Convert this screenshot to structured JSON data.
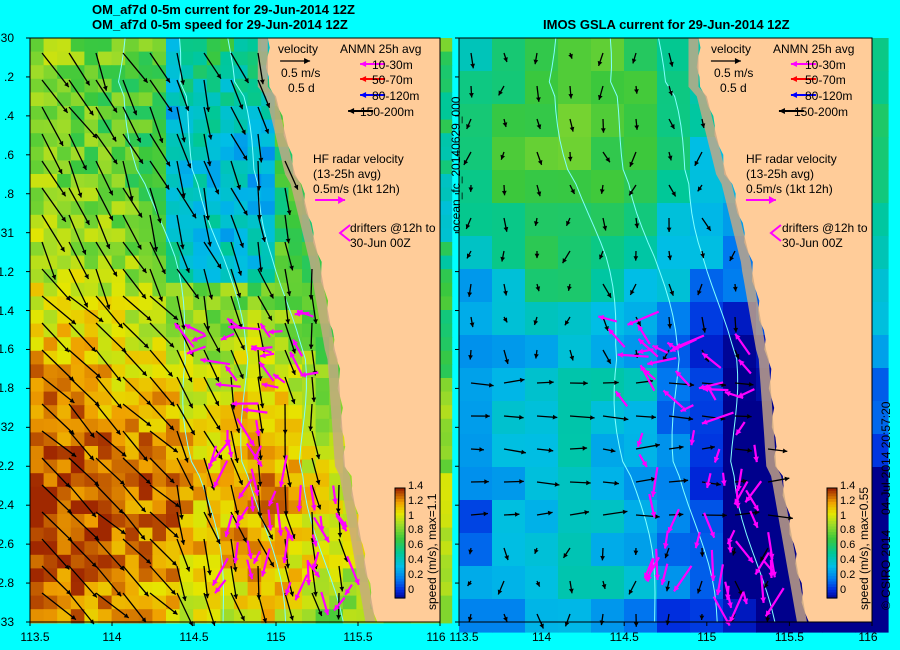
{
  "left_panel": {
    "title_line1": "OM_af7d 0-5m current for 29-Jun-2014 12Z",
    "title_line2": "OM_af7d 0-5m speed for 29-Jun-2014 12Z",
    "colorbar_label": "speed (m/s), max=1.1"
  },
  "right_panel": {
    "title_line1": "IMOS GSLA current for 29-Jun-2014 12Z",
    "side_label": "ocean_fc_20140629_000",
    "colorbar_label": "speed (m/s), max=0.55"
  },
  "legend": {
    "velocity_title": "velocity",
    "velocity_scale": "0.5 m/s",
    "velocity_time": "0.5 d",
    "anmn_title": "ANMN 25h avg",
    "anmn_items": [
      {
        "label": "10-30m",
        "color": "#FF00FF"
      },
      {
        "label": "50-70m",
        "color": "#FF0000"
      },
      {
        "label": "80-120m",
        "color": "#0000FF"
      },
      {
        "label": "150-200m",
        "color": "#000000"
      }
    ],
    "hf_title": "HF radar velocity",
    "hf_avg": "(13-25h avg)",
    "hf_scale": "0.5m/s (1kt 12h)",
    "drifters_line1": "drifters @12h to",
    "drifters_line2": "30-Jun 00Z"
  },
  "y_ticks": [
    "-30",
    ".2",
    ".4",
    ".6",
    ".8",
    "-31",
    "1.2",
    "1.4",
    "1.6",
    "1.8",
    "-32",
    "2.2",
    "2.4",
    "2.6",
    "2.8",
    "-33"
  ],
  "x_ticks_left": [
    "113.5",
    "114",
    "114.5",
    "115",
    "115.5",
    "116"
  ],
  "x_ticks_right": [
    "113.5",
    "114",
    "114.5",
    "115",
    "115.5",
    "116"
  ],
  "colorbar_ticks": [
    "1.4",
    "1.2",
    "1",
    "0.8",
    "0.6",
    "0.4",
    "0.2",
    "0"
  ],
  "footer": {
    "copyright": "© CSIRO 2014",
    "timestamp": "04-Jul-2014 20:57:20"
  },
  "colors": {
    "background": "#00FFFF",
    "land": "#FFCC99",
    "hf_arrow": "#FF00FF",
    "model_arrow": "#000000"
  }
}
